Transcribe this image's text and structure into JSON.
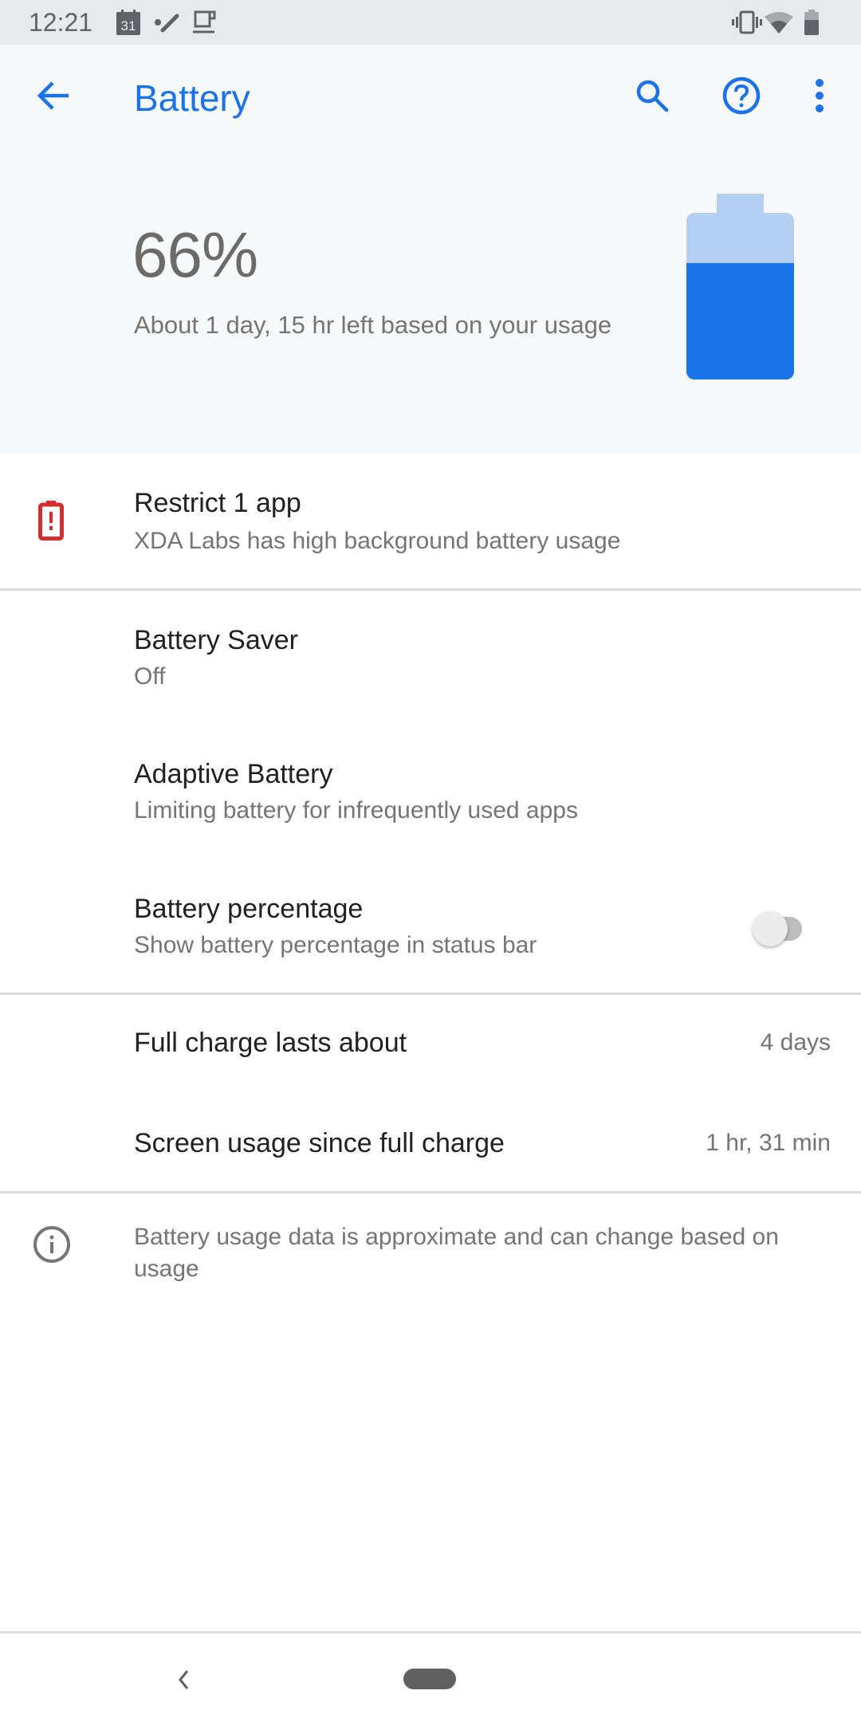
{
  "status_bar": {
    "time": "12:21",
    "notification_icons": [
      "calendar-icon",
      "pencil-icon",
      "coffee-icon"
    ],
    "calendar_day": "31",
    "system_icons": [
      "vibrate-icon",
      "wifi-icon",
      "battery-icon"
    ]
  },
  "app_bar": {
    "title": "Battery",
    "back_icon": "arrow-back-icon",
    "actions": [
      "search-icon",
      "help-icon",
      "more-vert-icon"
    ]
  },
  "battery_header": {
    "percent_label": "66%",
    "level": 0.66,
    "remaining": "About 1 day, 15 hr left based on your usage"
  },
  "items": {
    "restrict": {
      "title": "Restrict 1 app",
      "summary": "XDA Labs has high background battery usage",
      "icon": "battery-alert-icon"
    },
    "saver": {
      "title": "Battery Saver",
      "summary": "Off"
    },
    "adaptive": {
      "title": "Adaptive Battery",
      "summary": "Limiting battery for infrequently used apps"
    },
    "percentage": {
      "title": "Battery percentage",
      "summary": "Show battery percentage in status bar",
      "toggle_on": false
    },
    "full_charge": {
      "title": "Full charge lasts about",
      "value": "4 days"
    },
    "screen_usage": {
      "title": "Screen usage since full charge",
      "value": "1 hr, 31 min"
    }
  },
  "footer": {
    "icon": "info-icon",
    "text": "Battery usage data is approximate and can change based on usage"
  },
  "nav_bar": {
    "buttons": [
      "back-nav",
      "home-pill"
    ]
  },
  "colors": {
    "accent": "#1a73e8",
    "accent_light": "#b3cff3",
    "alert": "#d32f2f",
    "status_bar_bg": "#e8e9eb",
    "header_bg": "#f7f9fb"
  }
}
